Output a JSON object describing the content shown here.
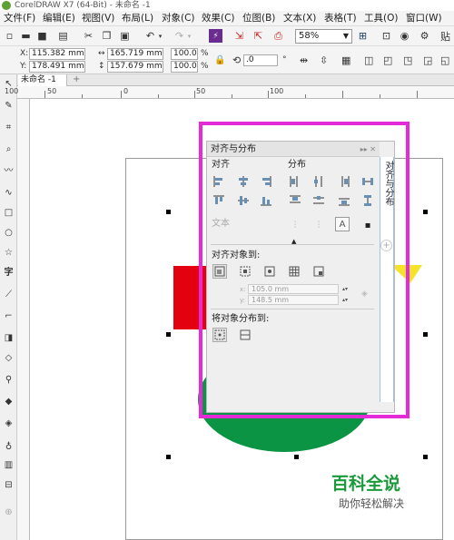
{
  "app": {
    "title": "CorelDRAW X7 (64-Bit) - 未命名 -1"
  },
  "menu": [
    "文件(F)",
    "编辑(E)",
    "视图(V)",
    "布局(L)",
    "对象(C)",
    "效果(C)",
    "位图(B)",
    "文本(X)",
    "表格(T)",
    "工具(O)",
    "窗口(W)"
  ],
  "toolbar": {
    "zoom": "58%",
    "tail_label": "贴"
  },
  "properties": {
    "x": "115.382 mm",
    "y": "178.491 mm",
    "w": "165.719 mm",
    "h": "157.679 mm",
    "scale_w": "100.0",
    "scale_h": "100.0",
    "scale_unit": "%",
    "rotation": ".0"
  },
  "document_tab": {
    "label": "未命名 -1",
    "add": "+"
  },
  "ruler": {
    "ticks": [
      "100",
      "50",
      "0",
      "50",
      "100"
    ]
  },
  "docker": {
    "title": "对齐与分布",
    "align_heading": "对齐",
    "distribute_heading": "分布",
    "text_label": "文本",
    "align_to_heading": "对齐对象到:",
    "x_label": "x:",
    "x_value": "105.0 mm",
    "y_label": "y:",
    "y_value": "148.5 mm",
    "distribute_to_heading": "将对象分布到:",
    "side_tab": "对齐与分布",
    "side_add": "+"
  },
  "colors": {
    "highlight": "#e52ad8",
    "red_rect": "#e3000f",
    "green_ellipse": "#0a9443",
    "yellow_star": "#f5e22a",
    "watermark": "#1a9a3a"
  },
  "watermark": {
    "title": "百科全说",
    "subtitle": "助你轻松解决"
  }
}
